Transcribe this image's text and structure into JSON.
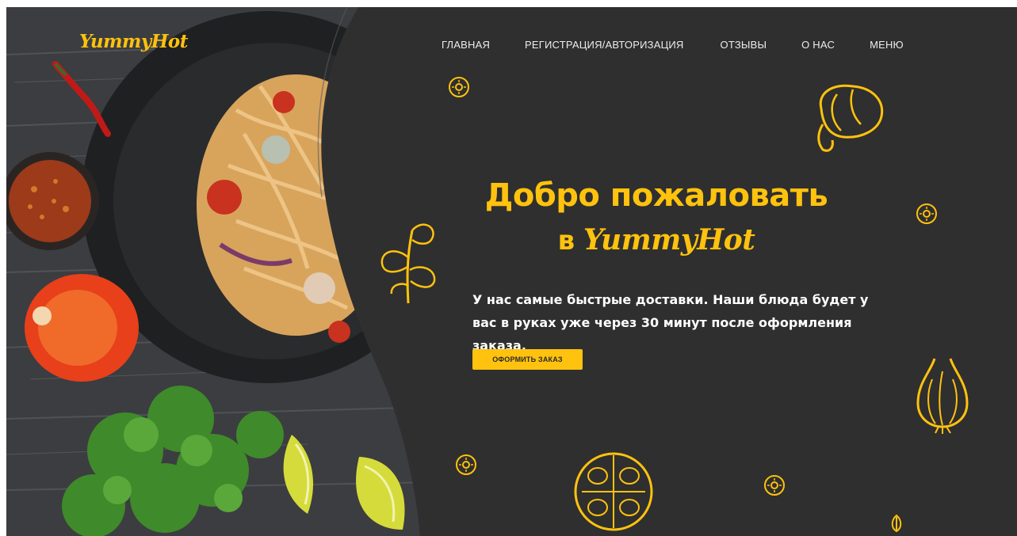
{
  "brand": {
    "logo_text": "YummyHot",
    "accent_color": "#ffc20e"
  },
  "nav": {
    "items": [
      {
        "label": "ГЛАВНАЯ"
      },
      {
        "label": "РЕГИСТРАЦИЯ/АВТОРИЗАЦИЯ"
      },
      {
        "label": "ОТЗЫВЫ"
      },
      {
        "label": "О НАС"
      },
      {
        "label": "МЕНЮ"
      }
    ]
  },
  "hero": {
    "title_line1": "Добро пожаловать",
    "title_prefix": "в",
    "title_brand": "YummyHot",
    "description": "У нас самые быстрые доставки. Наши блюда будет у вас в руках уже через 30 минут после оформления заказа.",
    "cta_label": "ОФОРМИТЬ ЗАКАЗ"
  },
  "colors": {
    "background": "#2f2f2f",
    "text": "#ffffff"
  },
  "decor_icons": [
    "food-photo",
    "pepper-doodle-icon",
    "parsley-doodle-icon",
    "garlic-doodle-icon",
    "tomato-slice-doodle-icon",
    "flower-doodle-icon"
  ]
}
